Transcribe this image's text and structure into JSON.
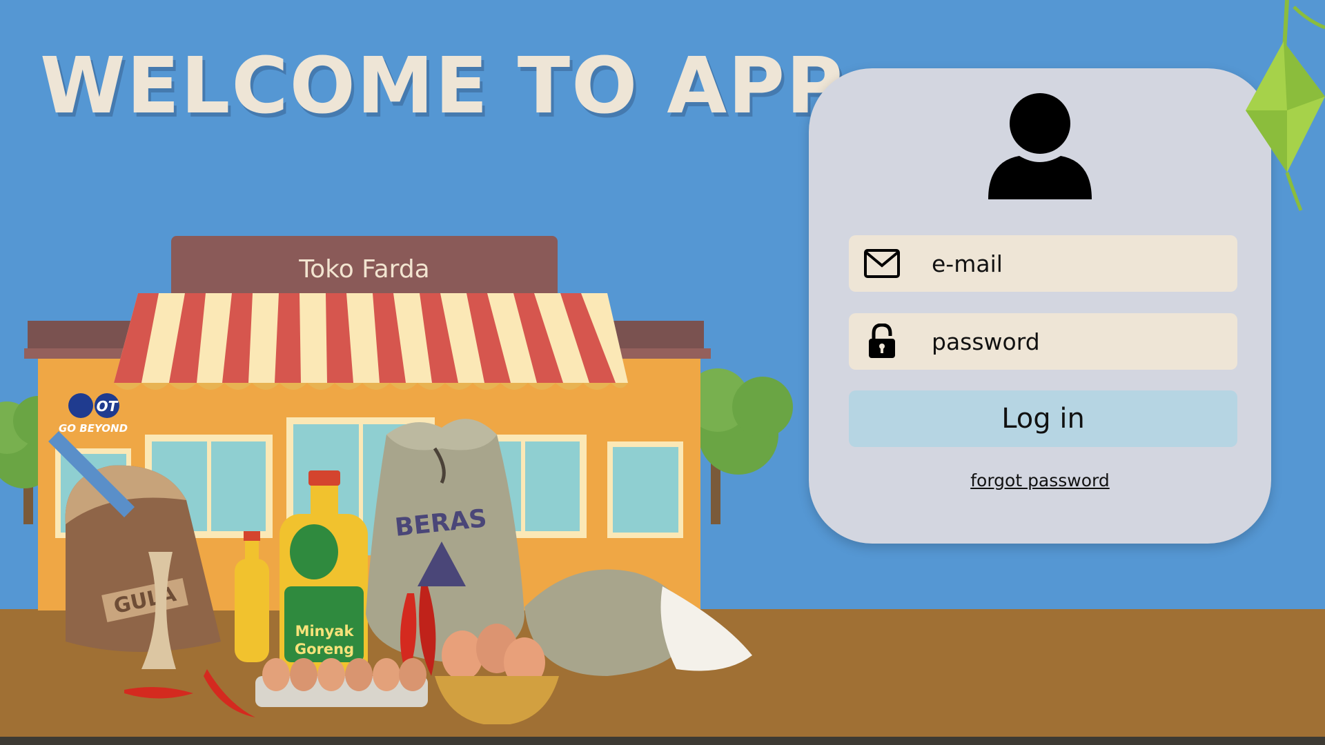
{
  "page": {
    "title": "WELCOME TO APP",
    "background_color": "#5597d3"
  },
  "store": {
    "sign": "Toko Farda",
    "products": [
      {
        "name": "sugar-sack",
        "label": "GULA"
      },
      {
        "name": "rice-sack",
        "label": "BERAS"
      },
      {
        "name": "cooking-oil-bottle",
        "label": [
          "Minyak",
          "Goreng"
        ]
      }
    ],
    "logo": {
      "monogram": "OT",
      "tagline": "GO BEYOND"
    }
  },
  "login": {
    "avatar_icon": "user-silhouette-icon",
    "email": {
      "placeholder": "e-mail",
      "icon": "envelope-icon",
      "value": ""
    },
    "password": {
      "placeholder": "password",
      "icon": "padlock-icon",
      "value": ""
    },
    "submit_label": "Log in",
    "forgot_label": "forgot password",
    "colors": {
      "card": "#d3d6e0",
      "field": "#eee5d6",
      "button": "#b6d5e3"
    }
  },
  "decorations": {
    "top_right": "ketupat-icon"
  }
}
